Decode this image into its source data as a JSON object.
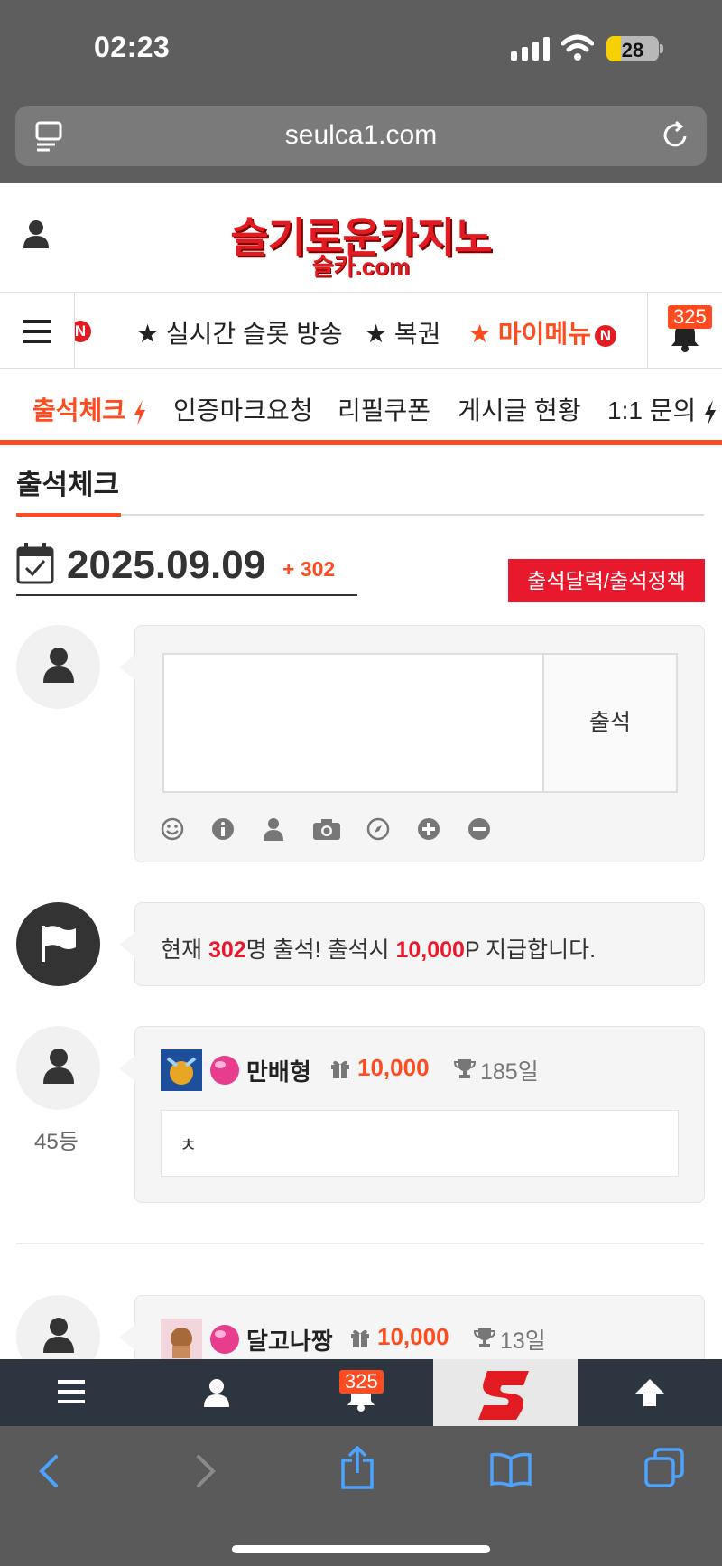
{
  "status_bar": {
    "time": "02:23",
    "battery": "28"
  },
  "browser": {
    "url": "seulca1.com"
  },
  "header": {
    "logo_main": "슬기로운카지노",
    "logo_sub": "슬카.com"
  },
  "nav1": {
    "items": [
      "★ 실시간 슬롯 방송",
      "★ 복권",
      "★ 마이메뉴"
    ],
    "partial_badge": "N",
    "new_badge": "N",
    "notification_count": "325"
  },
  "nav2": {
    "items": [
      "출석체크",
      "인증마크요청",
      "리필쿠폰",
      "게시글 현황",
      "1:1 문의"
    ]
  },
  "page": {
    "title": "출석체크",
    "date": "2025.09.09",
    "attend_count": "+ 302",
    "policy_button": "출석달력/출석정책",
    "submit_label": "출석",
    "notice": {
      "prefix": "현재 ",
      "count": "302",
      "mid": "명 출석! 출석시 ",
      "points": "10,000",
      "suffix": "P 지급합니다."
    }
  },
  "entries": [
    {
      "name": "만배형",
      "points": "10,000",
      "days": "185일",
      "comment": "ㅊ",
      "rank": "45등"
    },
    {
      "name": "달고나짱",
      "points": "10,000",
      "days": "13일"
    }
  ],
  "bottom_nav": {
    "notification_count": "325"
  },
  "colors": {
    "accent": "#ff4b1f",
    "brand_red": "#e21b22",
    "bottom_nav": "#2d3540"
  }
}
